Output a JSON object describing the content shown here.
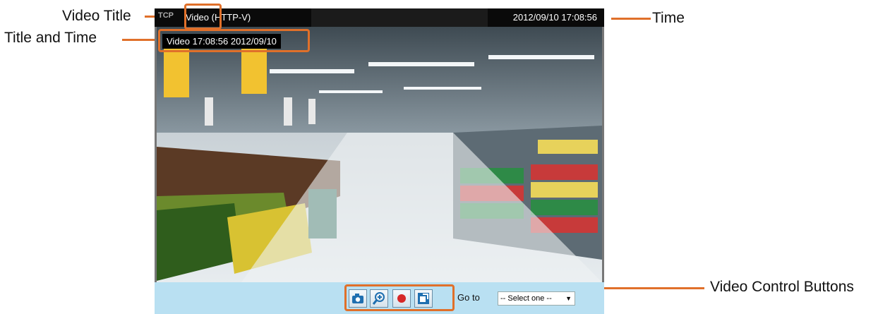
{
  "callouts": {
    "video_title": "Video Title",
    "title_and_time": "Title and Time",
    "time": "Time",
    "video_control_buttons": "Video Control Buttons"
  },
  "titlebar": {
    "protocol": "TCP",
    "video_title": "Video (HTTP-V)",
    "datetime": "2012/09/10  17:08:56"
  },
  "overlay": {
    "text": "Video 17:08:56  2012/09/10"
  },
  "controls": {
    "buttons": [
      "snapshot-icon",
      "digital-zoom-icon",
      "record-icon",
      "fullscreen-icon"
    ],
    "goto_label": "Go to",
    "select_value": "-- Select one --"
  },
  "colors": {
    "accent": "#e0702a",
    "titlebar_bg": "#0a0a0a",
    "controlbar_bg": "#b9e0f2"
  }
}
